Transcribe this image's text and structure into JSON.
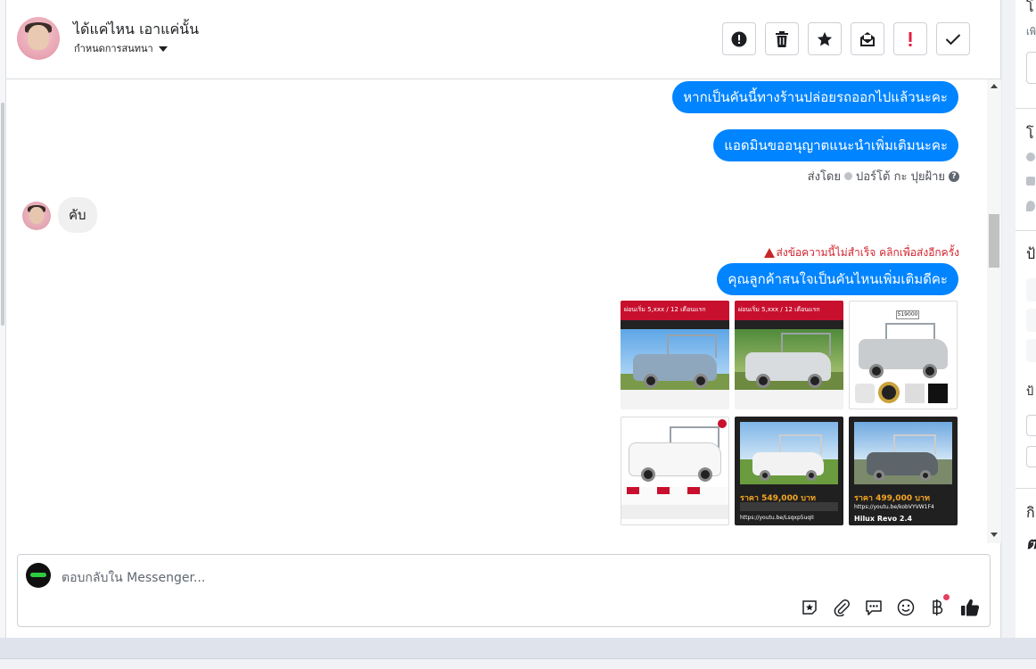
{
  "header": {
    "contact_name": "ได้แค่ไหน เอาแค่นั้น",
    "assign_label": "กำหนดการสนทนา"
  },
  "toolbar": {
    "buttons": [
      {
        "name": "spam",
        "icon": "exclamation-circle-icon"
      },
      {
        "name": "delete",
        "icon": "trash-icon"
      },
      {
        "name": "star",
        "icon": "star-icon"
      },
      {
        "name": "unread",
        "icon": "envelope-icon"
      },
      {
        "name": "important",
        "icon": "exclamation-icon"
      },
      {
        "name": "done",
        "icon": "check-icon"
      }
    ]
  },
  "messages": {
    "out1": "หากเป็นคันนี้ทางร้านปล่อยรถออกไปแล้วนะคะ",
    "out2": "แอดมินขออนุญาตแนะนำเพิ่มเติมนะคะ",
    "sent_by_prefix": "ส่งโดย",
    "sent_by_name": "ปอร์โต้ กะ ปุยฝ้าย",
    "in1": "คับ",
    "send_failed": "ส่งข้อความนี้ไม่สำเร็จ คลิกเพื่อส่งอีกครั้ง",
    "out3": "คุณลูกค้าสนใจเป็นคันไหนเพิ่มเติมดีคะ"
  },
  "thumbnails": {
    "t1_title": "ผ่อนเริ่ม 5,xxx / 12 เดือนแรก",
    "t2_title": "ผ่อนเริ่ม 5,xxx / 12 เดือนแรก",
    "t3_price": "519000",
    "t5_price": "ราคา 549,000 บาท",
    "t5_link": "https://youtu.be/Lsqxp5uqII",
    "t6_price": "ราคา 499,000 บาท",
    "t6_link": "https://youtu.be/kobVYVW1F4",
    "t6_model": "Hilux Revo 2.4"
  },
  "composer": {
    "placeholder": "ตอบกลับใน Messenger...",
    "icons": [
      "sticker-icon",
      "attachment-icon",
      "saved-reply-icon",
      "emoji-icon",
      "baht-payment-icon",
      "like-icon"
    ]
  },
  "right_panel": {
    "c1": "โ",
    "c2": "เพิ",
    "c3": "โ",
    "c4": "ป้",
    "c5": "ป้",
    "c6": "กิ",
    "c7": "ต"
  },
  "colors": {
    "messenger_blue": "#0084ff",
    "error_red": "#d4242d",
    "incoming_bubble": "#f1f0f0"
  }
}
